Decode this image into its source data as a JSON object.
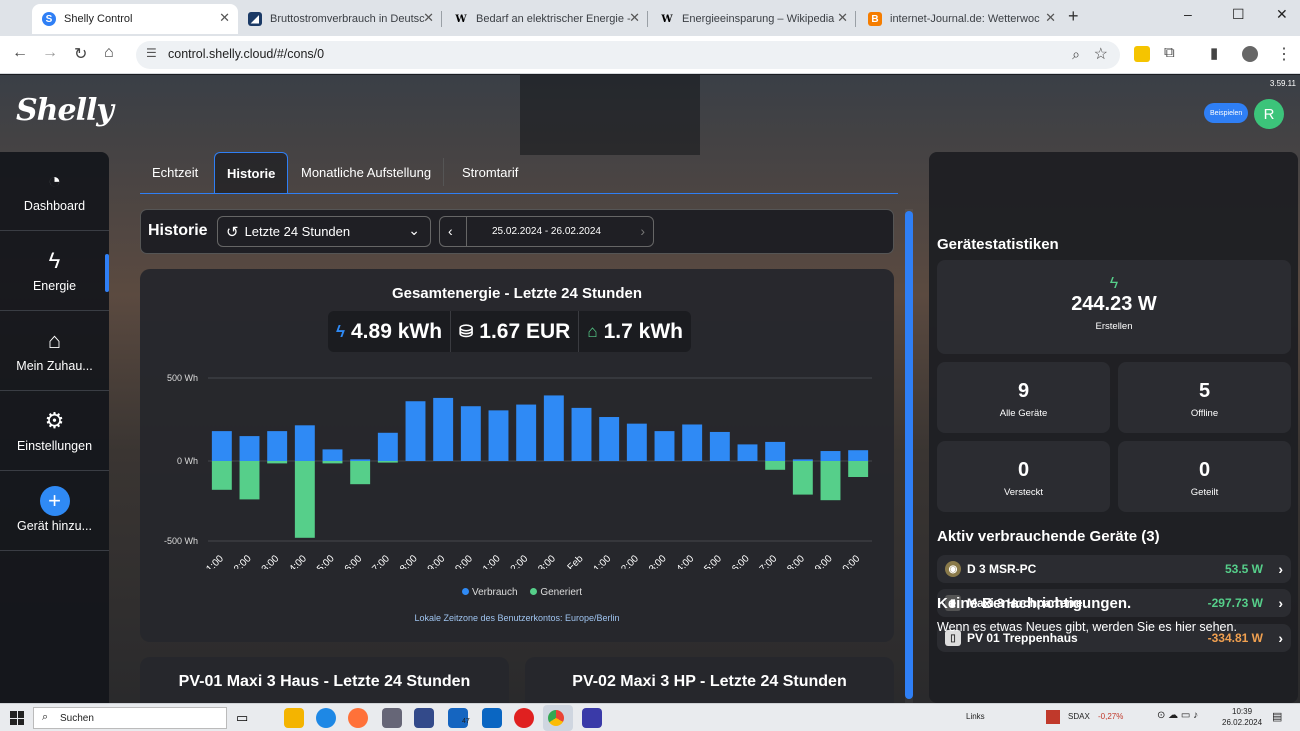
{
  "browser": {
    "tabs": [
      {
        "title": "Shelly Control",
        "icon": "shelly-favicon",
        "active": true
      },
      {
        "title": "Bruttostromverbrauch in Deutsc",
        "icon": "statista-favicon"
      },
      {
        "title": "Bedarf an elektrischer Energie -",
        "icon": "wikipedia-favicon"
      },
      {
        "title": "Energieeinsparung – Wikipedia",
        "icon": "wikipedia-favicon"
      },
      {
        "title": "internet-Journal.de: Wetterwoc",
        "icon": "blogger-favicon"
      }
    ],
    "url": "control.shelly.cloud/#/cons/0",
    "new_tab": "+",
    "window_controls": [
      "–",
      "☐",
      "✕"
    ]
  },
  "app": {
    "logo": "Shelly",
    "version": "3.59.11",
    "example_badge": "Beispielen",
    "avatar_letter": "R"
  },
  "sidebar": {
    "items": [
      {
        "label": "Dashboard",
        "icon": "speedometer-icon"
      },
      {
        "label": "Energie",
        "icon": "lightning-icon",
        "active": true
      },
      {
        "label": "Mein Zuhau...",
        "icon": "home-icon"
      },
      {
        "label": "Einstellungen",
        "icon": "gear-icon"
      },
      {
        "label": "Gerät hinzu...",
        "icon": "plus-icon"
      }
    ]
  },
  "tabs": [
    {
      "label": "Echtzeit"
    },
    {
      "label": "Historie",
      "active": true
    },
    {
      "label": "Monatliche Aufstellung"
    },
    {
      "label": "Stromtarif"
    }
  ],
  "history_bar": {
    "title": "Historie",
    "range_select": "Letzte 24 Stunden",
    "date_range": "25.02.2024 - 26.02.2024"
  },
  "summary": {
    "consumption": "4.89 kWh",
    "cost": "1.67 EUR",
    "generated": "1.7 kWh"
  },
  "chart_data": {
    "type": "bar",
    "title": "Gesamtenergie - Letzte 24 Stunden",
    "categories": [
      "11:00",
      "12:00",
      "13:00",
      "14:00",
      "15:00",
      "16:00",
      "17:00",
      "18:00",
      "19:00",
      "20:00",
      "21:00",
      "22:00",
      "23:00",
      "26.Feb",
      "01:00",
      "02:00",
      "03:00",
      "04:00",
      "05:00",
      "06:00",
      "07:00",
      "08:00",
      "09:00",
      "10:00"
    ],
    "series": [
      {
        "name": "Verbrauch",
        "color": "#2f8af5",
        "values": [
          180,
          150,
          180,
          215,
          70,
          10,
          170,
          360,
          380,
          330,
          305,
          340,
          395,
          320,
          265,
          225,
          180,
          220,
          175,
          100,
          115,
          10,
          60,
          65
        ]
      },
      {
        "name": "Generiert",
        "color": "#56cf8a",
        "values": [
          -180,
          -240,
          -15,
          -480,
          -15,
          -145,
          -10,
          0,
          0,
          0,
          0,
          0,
          0,
          0,
          0,
          0,
          0,
          0,
          0,
          0,
          -55,
          -210,
          -245,
          -100
        ]
      }
    ],
    "y_ticks": [
      "500 Wh",
      "0 Wh",
      "-500 Wh"
    ],
    "ylim": [
      -500,
      500
    ],
    "timezone_note": "Lokale Zeitzone des Benutzerkontos: Europe/Berlin"
  },
  "subcards": [
    {
      "title": "PV-01 Maxi 3 Haus - Letzte 24 Stunden"
    },
    {
      "title": "PV-02 Maxi 3 HP - Letzte 24 Stunden"
    }
  ],
  "device_stats": {
    "title": "Gerätestatistiken",
    "power": "244.23 W",
    "power_label": "Erstellen",
    "boxes": [
      {
        "value": "9",
        "label": "Alle Geräte"
      },
      {
        "value": "5",
        "label": "Offline"
      },
      {
        "value": "0",
        "label": "Versteckt"
      },
      {
        "value": "0",
        "label": "Geteilt"
      }
    ]
  },
  "active_devices": {
    "title": "Aktiv verbrauchende Geräte (3)",
    "items": [
      {
        "name": "D 3 MSR-PC",
        "power": "53.5 W",
        "color": "#56cf8a"
      },
      {
        "name": "Maxi 3 Hochparterre",
        "power": "-297.73 W",
        "color": "#56cf8a"
      },
      {
        "name": "PV 01 Treppenhaus",
        "power": "-334.81 W",
        "color": "#f0a050"
      }
    ]
  },
  "notifications": {
    "title": "Keine Benachrichtigungen.",
    "text": "Wenn es etwas Neues gibt, werden Sie es hier sehen."
  },
  "taskbar": {
    "search": "Suchen",
    "links": "Links",
    "ticker": "SDAX",
    "ticker_change": "-0,27%",
    "mail_count": "47",
    "time": "10:39",
    "date": "26.02.2024"
  }
}
